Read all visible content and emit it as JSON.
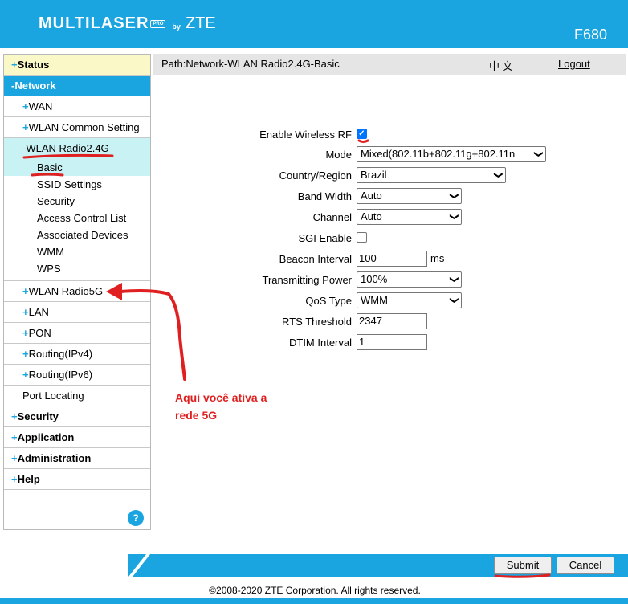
{
  "header": {
    "brand": "MULTILASER",
    "brand_badge": "PRO",
    "brand_by": "by",
    "brand_zte": "ZTE",
    "model": "F680"
  },
  "nav": {
    "status": "Status",
    "network": "Network",
    "network_items": [
      {
        "label": "WAN",
        "prefix": "+"
      },
      {
        "label": "WLAN Common Setting",
        "prefix": "+"
      },
      {
        "label": "WLAN Radio2.4G",
        "prefix": "-"
      }
    ],
    "radio24_items": [
      "Basic",
      "SSID Settings",
      "Security",
      "Access Control List",
      "Associated Devices",
      "WMM",
      "WPS"
    ],
    "network_items_after": [
      {
        "label": "WLAN Radio5G",
        "prefix": "+"
      },
      {
        "label": "LAN",
        "prefix": "+"
      },
      {
        "label": "PON",
        "prefix": "+"
      },
      {
        "label": "Routing(IPv4)",
        "prefix": "+"
      },
      {
        "label": "Routing(IPv6)",
        "prefix": "+"
      },
      {
        "label": "Port Locating",
        "prefix": ""
      }
    ],
    "top_items": [
      "Security",
      "Application",
      "Administration",
      "Help"
    ],
    "help_icon": "?"
  },
  "pathbar": {
    "path": "Path:Network-WLAN Radio2.4G-Basic",
    "lang": "中 文",
    "logout": "Logout"
  },
  "form": {
    "enable_rf_label": "Enable Wireless RF",
    "enable_rf_checked": true,
    "mode_label": "Mode",
    "mode_value": "Mixed(802.11b+802.11g+802.11n",
    "country_label": "Country/Region",
    "country_value": "Brazil",
    "bandwidth_label": "Band Width",
    "bandwidth_value": "Auto",
    "channel_label": "Channel",
    "channel_value": "Auto",
    "sgi_label": "SGI Enable",
    "sgi_checked": false,
    "beacon_label": "Beacon Interval",
    "beacon_value": "100",
    "beacon_unit": "ms",
    "txpower_label": "Transmitting Power",
    "txpower_value": "100%",
    "qos_label": "QoS Type",
    "qos_value": "WMM",
    "rts_label": "RTS Threshold",
    "rts_value": "2347",
    "dtim_label": "DTIM Interval",
    "dtim_value": "1"
  },
  "buttons": {
    "submit": "Submit",
    "cancel": "Cancel"
  },
  "copyright": "©2008-2020 ZTE Corporation. All rights reserved.",
  "annotation": {
    "line1": "Aqui você ativa a",
    "line2": "rede 5G",
    "color": "#e02020"
  },
  "colors": {
    "accent": "#1aa5e0",
    "status_bg": "#fbf8c8",
    "active_bg": "#c8f2f4"
  }
}
